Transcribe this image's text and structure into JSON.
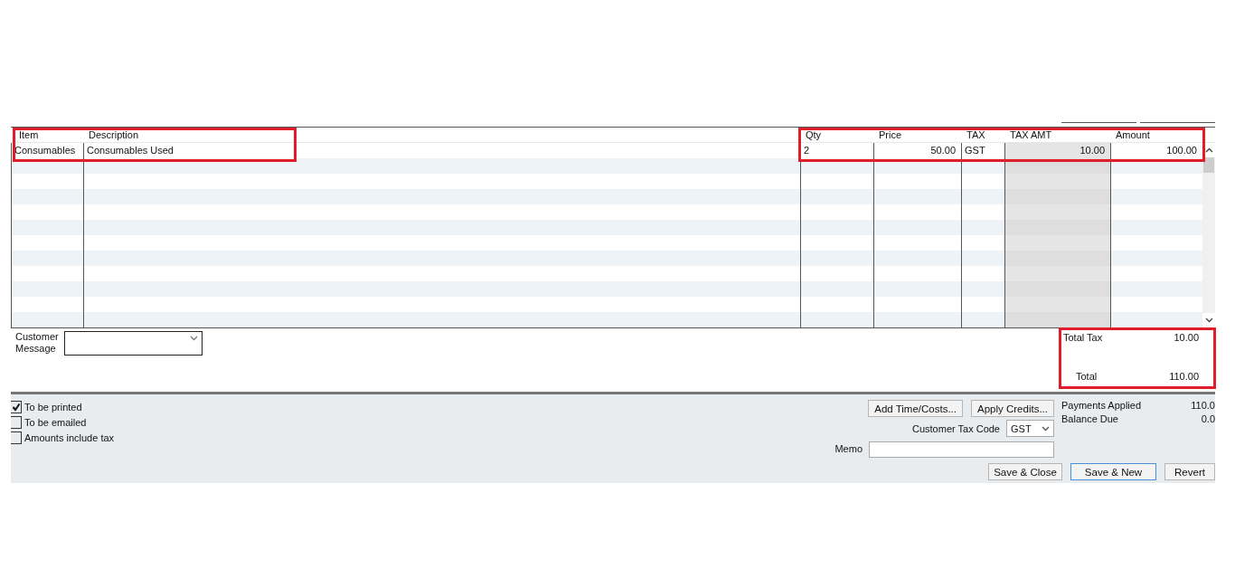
{
  "table": {
    "columns": [
      {
        "label": "Item",
        "kind": "text"
      },
      {
        "label": "Description",
        "kind": "text"
      },
      {
        "label": "Qty",
        "kind": "text"
      },
      {
        "label": "Price",
        "kind": "number"
      },
      {
        "label": "TAX",
        "kind": "text"
      },
      {
        "label": "TAX AMT",
        "kind": "computed"
      },
      {
        "label": "Amount",
        "kind": "number"
      }
    ],
    "rows": [
      {
        "cells": [
          "Consumables",
          "Consumables Used",
          "2",
          "50.00",
          "GST",
          "10.00",
          "100.00"
        ]
      }
    ]
  },
  "customer_message": {
    "label": "Customer Message"
  },
  "totals": [
    {
      "label": "Total Tax",
      "value": "10.00"
    },
    {
      "label": "Total",
      "value": "110.00"
    }
  ],
  "options": [
    {
      "label": "To be printed",
      "checked": true
    },
    {
      "label": "To be emailed",
      "checked": false
    },
    {
      "label": "Amounts include tax",
      "checked": false
    }
  ],
  "buttons": [
    "Add Time/Costs...",
    "Apply Credits..."
  ],
  "customer_tax_code": {
    "label": "Customer Tax Code",
    "value": "GST"
  },
  "memo": {
    "label": "Memo"
  },
  "payments": [
    {
      "label": "Payments Applied",
      "value": "110.0"
    },
    {
      "label": "Balance Due",
      "value": "0.0"
    }
  ],
  "actions": [
    {
      "label": "Save & Close",
      "default": false
    },
    {
      "label": "Save & New",
      "default": true
    },
    {
      "label": "Revert",
      "default": false
    }
  ]
}
